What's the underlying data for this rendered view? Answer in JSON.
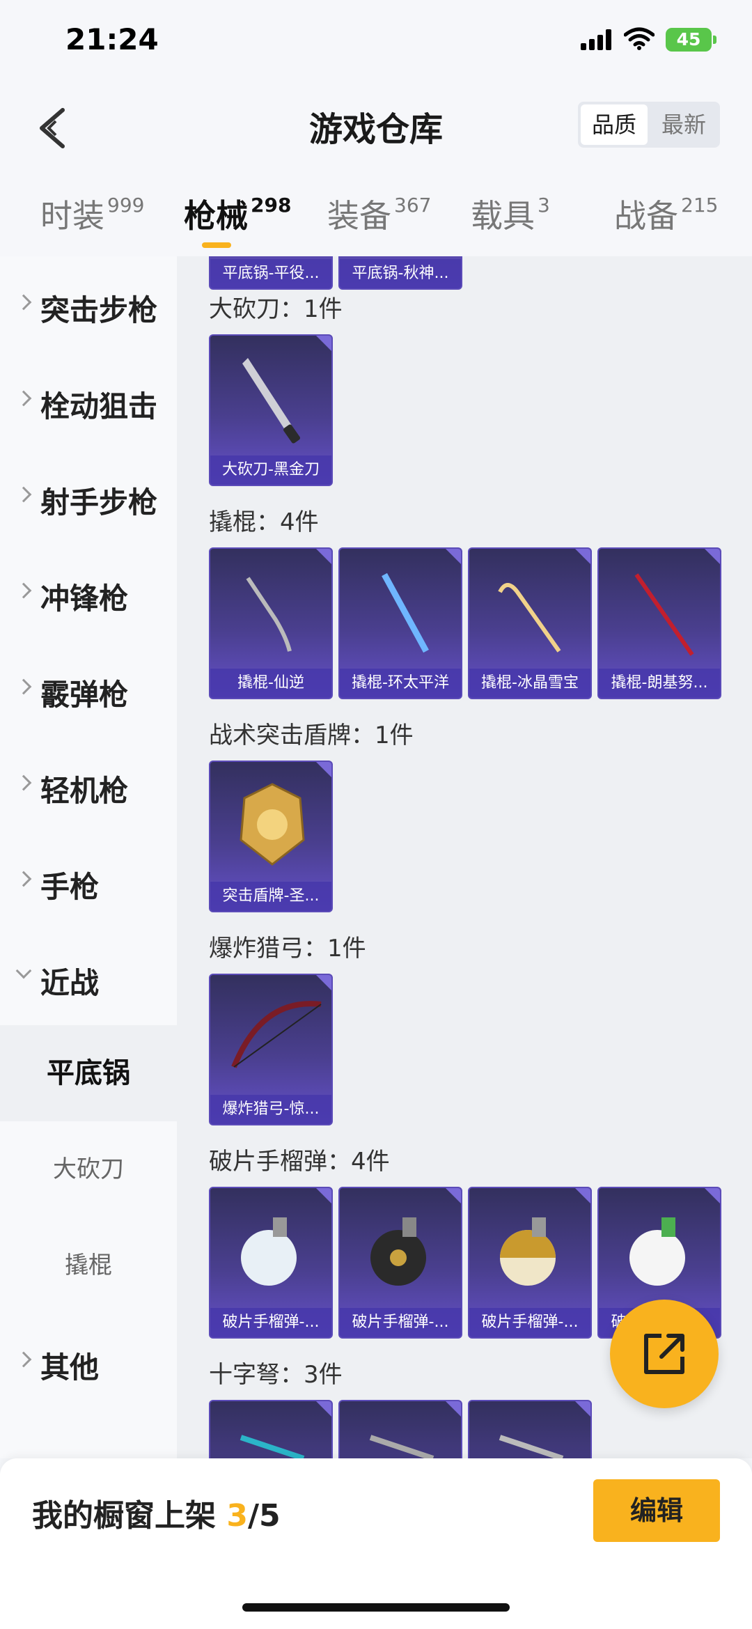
{
  "status": {
    "time": "21:24",
    "battery": "45"
  },
  "header": {
    "title": "游戏仓库",
    "sort_quality": "品质",
    "sort_newest": "最新"
  },
  "tabs": [
    {
      "label": "时装",
      "count": "999"
    },
    {
      "label": "枪械",
      "count": "298"
    },
    {
      "label": "装备",
      "count": "367"
    },
    {
      "label": "载具",
      "count": "3"
    },
    {
      "label": "战备",
      "count": "215"
    }
  ],
  "sidebar": {
    "categories": [
      "突击步枪",
      "栓动狙击",
      "射手步枪",
      "冲锋枪",
      "霰弹枪",
      "轻机枪",
      "手枪",
      "近战",
      "其他"
    ],
    "subcategories": [
      "平底锅",
      "大砍刀",
      "撬棍"
    ]
  },
  "sections": [
    {
      "title": "大砍刀：1件",
      "items": [
        "大砍刀-黑金刀"
      ]
    },
    {
      "title": "撬棍：4件",
      "items": [
        "撬棍-仙逆",
        "撬棍-环太平洋",
        "撬棍-冰晶雪宝",
        "撬棍-朗基努..."
      ]
    },
    {
      "title": "战术突击盾牌：1件",
      "items": [
        "突击盾牌-圣..."
      ]
    },
    {
      "title": "爆炸猎弓：1件",
      "items": [
        "爆炸猎弓-惊..."
      ]
    },
    {
      "title": "破片手榴弹：4件",
      "items": [
        "破片手榴弹-...",
        "破片手榴弹-...",
        "破片手榴弹-...",
        "破片手榴弹-..."
      ]
    },
    {
      "title": "十字弩：3件",
      "items": [
        "",
        "",
        ""
      ]
    }
  ],
  "top_partial_items": [
    "平底锅-平役...",
    "平底锅-秋神..."
  ],
  "bottom": {
    "showcase_label": "我的橱窗上架 ",
    "showcase_current": "3",
    "showcase_total": "/5",
    "edit_label": "编辑"
  },
  "colors": {
    "accent": "#f9b21e",
    "card_bg": "#4a3f8f"
  }
}
